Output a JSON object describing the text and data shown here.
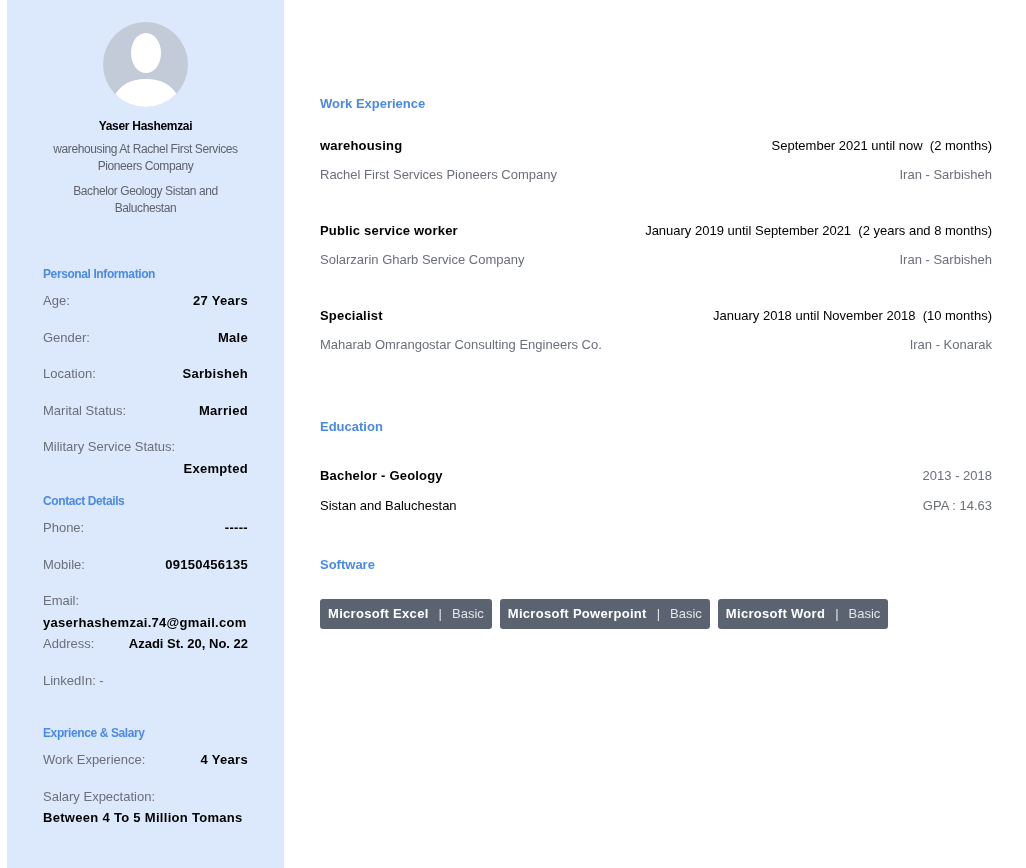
{
  "profile": {
    "name": "Yaser Hashemzai",
    "headline": "warehousing At Rachel First Services Pioneers Company",
    "education_line": "Bachelor Geology Sistan and Baluchestan"
  },
  "sidebar_sections": [
    {
      "title": "Personal Information",
      "rows": [
        {
          "kind": "inline",
          "label": "Age:",
          "value": "27 Years"
        },
        {
          "kind": "inline",
          "label": "Gender:",
          "value": "Male"
        },
        {
          "kind": "inline",
          "label": "Location:",
          "value": "Sarbisheh"
        },
        {
          "kind": "inline",
          "label": "Marital Status:",
          "value": "Married"
        },
        {
          "kind": "stacked_right",
          "label": "Military Service Status:",
          "value": "Exempted"
        }
      ]
    },
    {
      "title": "Contact Details",
      "rows": [
        {
          "kind": "inline",
          "label": "Phone:",
          "value": "-----"
        },
        {
          "kind": "inline",
          "label": "Mobile:",
          "value": "09150456135"
        },
        {
          "kind": "stacked_left",
          "label": "Email:",
          "value": "yaserhashemzai.74@gmail.com"
        },
        {
          "kind": "inline_tight",
          "label": "Address:",
          "value": "Azadi St. 20, No. 22"
        },
        {
          "kind": "plain",
          "text": "LinkedIn: -"
        }
      ]
    },
    {
      "title": "Exprience & Salary",
      "rows": [
        {
          "kind": "inline",
          "label": "Work Experience:",
          "value": "4 Years"
        },
        {
          "kind": "stacked_left",
          "label": "Salary Expectation:",
          "value": "Between 4 To 5 Million Tomans"
        }
      ]
    }
  ],
  "work_experience": {
    "title": "Work Experience",
    "items": [
      {
        "role": "warehousing",
        "period": "September 2021 until now  (2 months)",
        "company": "Rachel First Services Pioneers Company",
        "location": "Iran - Sarbisheh"
      },
      {
        "role": "Public service worker",
        "period": "January 2019 until September 2021  (2 years and 8 months)",
        "company": "Solarzarin Gharb Service Company",
        "location": "Iran - Sarbisheh"
      },
      {
        "role": "Specialist",
        "period": "January 2018 until November 2018  (10 months)",
        "company": "Maharab Omrangostar Consulting Engineers Co.",
        "location": "Iran - Konarak"
      }
    ]
  },
  "education": {
    "title": "Education",
    "items": [
      {
        "degree": "Bachelor - Geology",
        "years": "2013 - 2018",
        "university": "Sistan and Baluchestan",
        "gpa": "GPA : 14.63"
      }
    ]
  },
  "software": {
    "title": "Software",
    "items": [
      {
        "name": "Microsoft Excel",
        "separator": "|",
        "level": "Basic"
      },
      {
        "name": "Microsoft Powerpoint",
        "separator": "|",
        "level": "Basic"
      },
      {
        "name": "Microsoft Word",
        "separator": "|",
        "level": "Basic"
      }
    ]
  }
}
